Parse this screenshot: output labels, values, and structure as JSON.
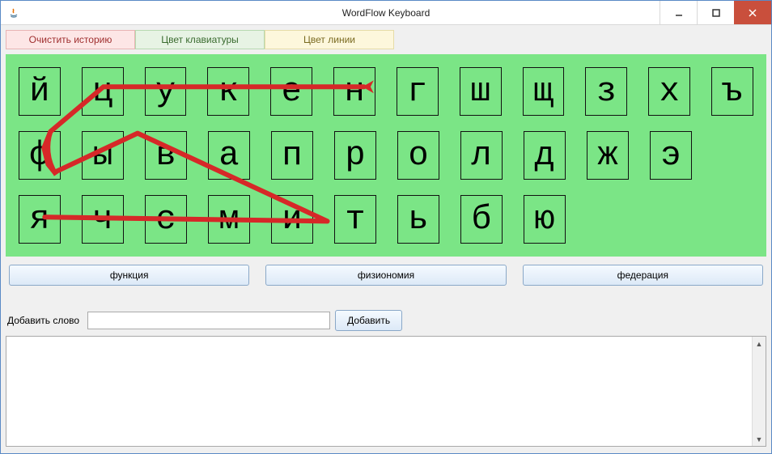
{
  "window": {
    "title": "WordFlow Keyboard"
  },
  "toolbar": {
    "clear_history": "Очистить историю",
    "keyboard_color": "Цвет клавиатуры",
    "line_color": "Цвет линии"
  },
  "keyboard": {
    "row1": [
      "й",
      "ц",
      "у",
      "к",
      "е",
      "н",
      "г",
      "ш",
      "щ",
      "з",
      "х",
      "ъ"
    ],
    "row2": [
      "ф",
      "ы",
      "в",
      "а",
      "п",
      "р",
      "о",
      "л",
      "д",
      "ж",
      "э"
    ],
    "row3": [
      "я",
      "ч",
      "с",
      "м",
      "и",
      "т",
      "ь",
      "б",
      "ю"
    ],
    "bg_color": "#7be586",
    "line_color": "#d62828"
  },
  "suggestions": [
    "функция",
    "физиономия",
    "федерация"
  ],
  "add_word": {
    "label": "Добавить слово",
    "value": "",
    "button": "Добавить"
  },
  "history_text": ""
}
